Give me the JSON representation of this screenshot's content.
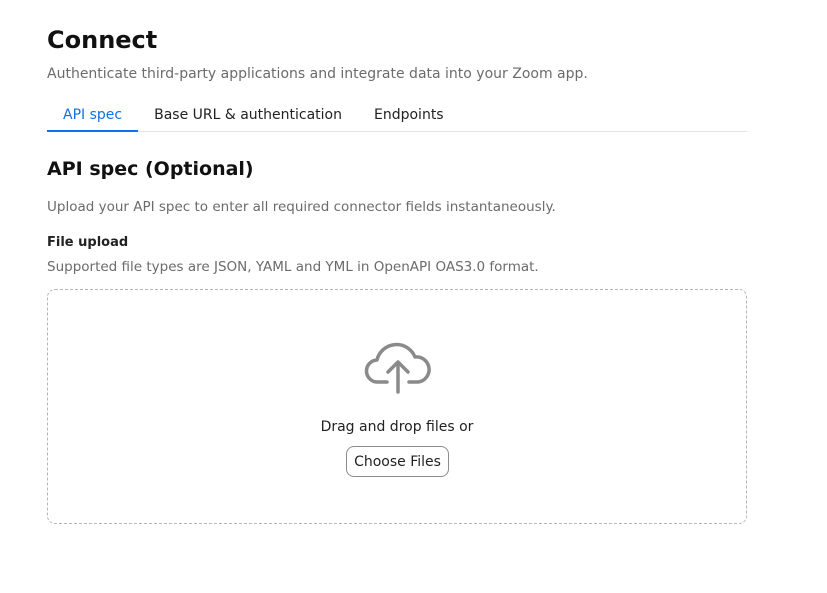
{
  "header": {
    "title": "Connect",
    "subtitle": "Authenticate third-party applications and integrate data into your Zoom app."
  },
  "tabs": [
    {
      "label": "API spec",
      "active": true
    },
    {
      "label": "Base URL & authentication",
      "active": false
    },
    {
      "label": "Endpoints",
      "active": false
    }
  ],
  "section": {
    "title": "API spec (Optional)",
    "description": "Upload your API spec to enter all required connector fields instantaneously."
  },
  "file_upload": {
    "label": "File upload",
    "help": "Supported file types are JSON, YAML and YML in OpenAPI OAS3.0 format.",
    "drop_text": "Drag and drop files or",
    "button_label": "Choose Files",
    "icon": "cloud-upload-icon"
  },
  "colors": {
    "accent": "#0e71eb",
    "muted_text": "#6b6b6b",
    "icon": "#8a8a8a"
  }
}
